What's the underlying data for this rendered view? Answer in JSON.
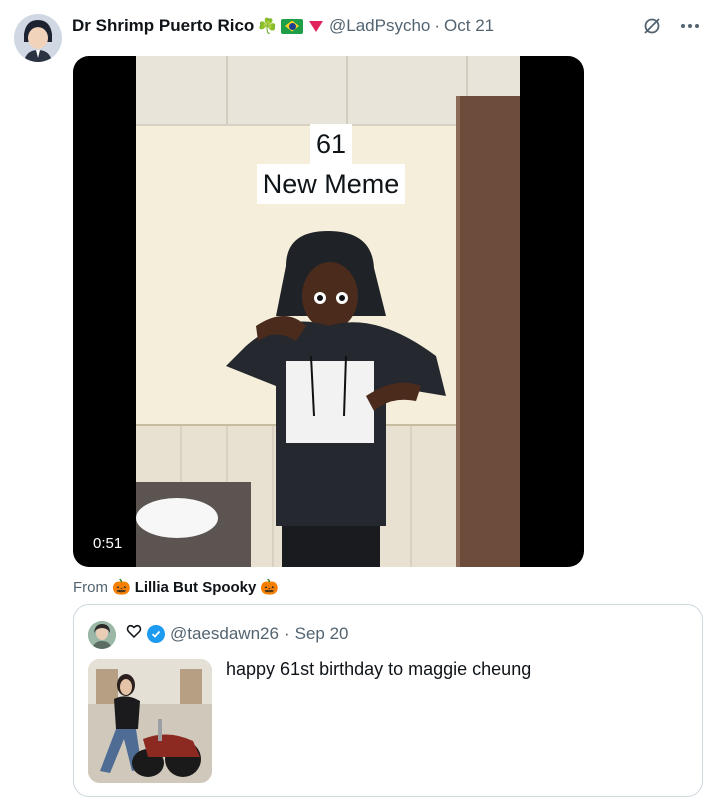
{
  "tweet": {
    "author_name": "Dr Shrimp Puerto Rico",
    "name_emojis": "☘️",
    "handle": "@LadPsycho",
    "separator": "·",
    "date": "Oct 21",
    "more_icon": "more-icon",
    "grok_icon": "grok-icon"
  },
  "video": {
    "caption_line1": "61",
    "caption_line2": "New Meme",
    "duration": "0:51"
  },
  "from": {
    "label": "From",
    "source": "Lillia But Spooky",
    "emoji": "🎃"
  },
  "quote": {
    "handle": "@taesdawn26",
    "separator": "·",
    "date": "Sep 20",
    "text": "happy 61st birthday to maggie cheung",
    "heart_icon": "heart-icon",
    "verified_icon": "verified-badge-icon"
  },
  "colors": {
    "secondary_text": "#536471",
    "verified_blue": "#1d9bf0",
    "border": "#cfd9de"
  }
}
